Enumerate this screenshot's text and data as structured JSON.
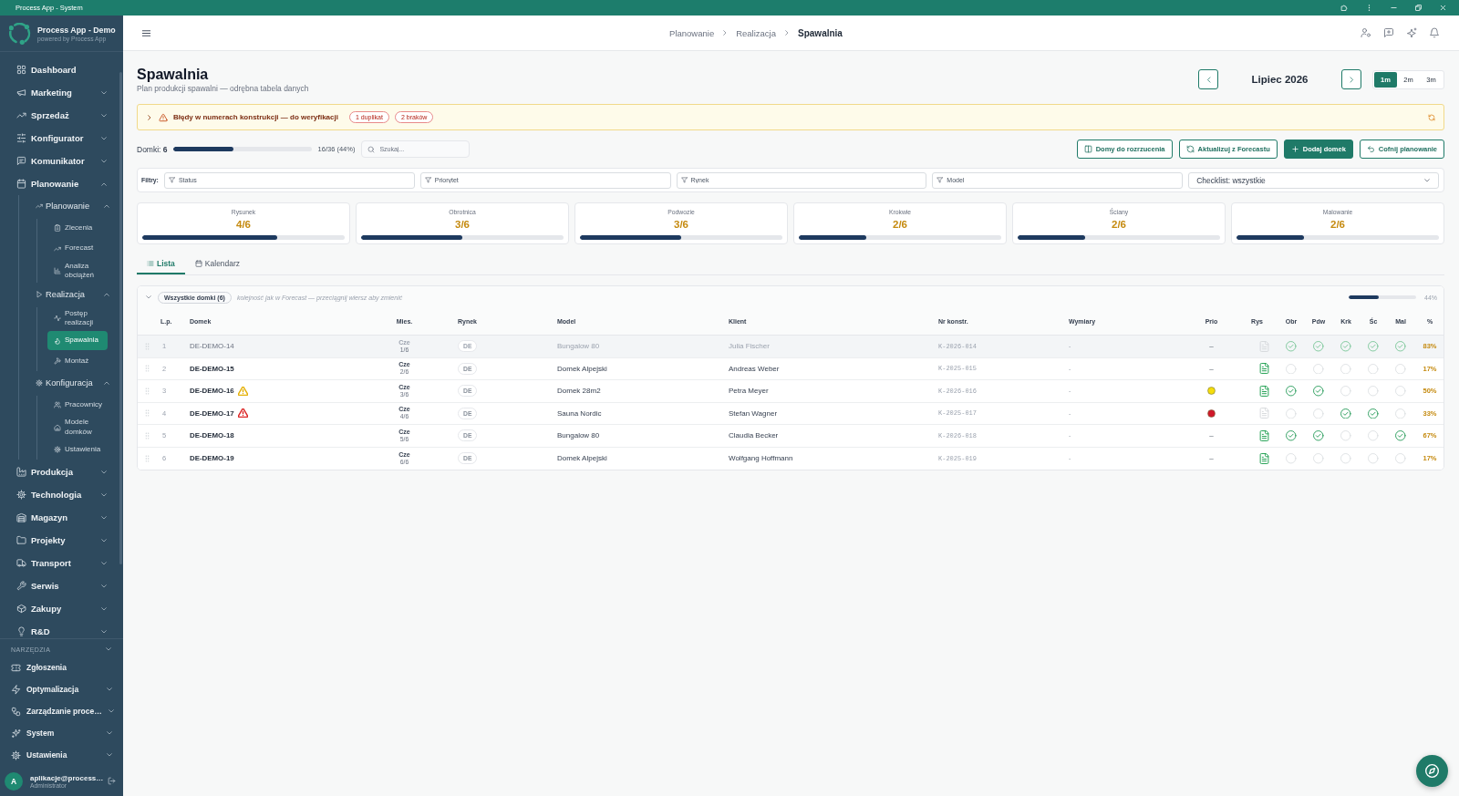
{
  "window": {
    "title": "Process App - System"
  },
  "sidebar": {
    "brand": {
      "name": "Process App - Demo",
      "tagline": "powered by Process App"
    },
    "items": [
      {
        "label": "Dashboard",
        "selected": false
      },
      {
        "label": "Marketing",
        "expanded": false,
        "selected": false
      },
      {
        "label": "Sprzedaż",
        "expanded": false,
        "selected": false
      },
      {
        "label": "Konfigurator",
        "expanded": false,
        "selected": false
      },
      {
        "label": "Komunikator",
        "expanded": false,
        "selected": false
      },
      {
        "label": "Planowanie",
        "expanded": true,
        "selected": false,
        "children": [
          {
            "label": "Planowanie",
            "expanded": true,
            "selected": false,
            "children": [
              {
                "label": "Zlecenia",
                "selected": false
              },
              {
                "label": "Forecast",
                "selected": false
              },
              {
                "label": "Analiza obciążeń",
                "selected": false
              }
            ]
          },
          {
            "label": "Realizacja",
            "expanded": true,
            "selected": false,
            "children": [
              {
                "label": "Postęp realizacji",
                "selected": false
              },
              {
                "label": "Spawalnia",
                "selected": true
              },
              {
                "label": "Montaż",
                "selected": false
              }
            ]
          },
          {
            "label": "Konfiguracja",
            "expanded": true,
            "selected": false,
            "children": [
              {
                "label": "Pracownicy",
                "selected": false
              },
              {
                "label": "Modele domków",
                "selected": false
              },
              {
                "label": "Ustawienia",
                "selected": false
              }
            ]
          }
        ]
      },
      {
        "label": "Produkcja",
        "expanded": false,
        "selected": false
      },
      {
        "label": "Technologia",
        "expanded": false,
        "selected": false
      },
      {
        "label": "Magazyn",
        "expanded": false,
        "selected": false
      },
      {
        "label": "Projekty",
        "expanded": false,
        "selected": false
      },
      {
        "label": "Transport",
        "expanded": false,
        "selected": false
      },
      {
        "label": "Serwis",
        "expanded": false,
        "selected": false
      },
      {
        "label": "Zakupy",
        "expanded": false,
        "selected": false
      },
      {
        "label": "R&D",
        "expanded": false,
        "selected": false
      }
    ],
    "tools": {
      "title": "NARZĘDZIA",
      "items": [
        {
          "label": "Zgłoszenia",
          "selected": false
        },
        {
          "label": "Optymalizacja",
          "expanded": false,
          "selected": false
        },
        {
          "label": "Zarządzanie proce…",
          "expanded": false,
          "selected": false
        },
        {
          "label": "System",
          "expanded": false,
          "selected": false
        },
        {
          "label": "Ustawienia",
          "expanded": false,
          "selected": false
        }
      ]
    },
    "user": {
      "initial": "A",
      "name": "aplikacje@process…",
      "role": "Administrator"
    }
  },
  "header": {
    "breadcrumb": [
      {
        "label": "Planowanie",
        "current": false
      },
      {
        "label": "Realizacja",
        "current": false
      },
      {
        "label": "Spawalnia",
        "current": true
      }
    ]
  },
  "page": {
    "title": "Spawalnia",
    "subtitle": "Plan produkcji spawalni — odrębna tabela danych"
  },
  "period": {
    "label": "Lipiec 2026",
    "ranges": [
      {
        "label": "1m",
        "selected": true
      },
      {
        "label": "2m",
        "selected": false
      },
      {
        "label": "3m",
        "selected": false
      }
    ]
  },
  "alert": {
    "expanded": false,
    "text": "Błędy w numerach konstrukcji — do weryfikacji",
    "badges": [
      "1 duplikat",
      "2 braków"
    ]
  },
  "summary": {
    "text": "Domki: **6**",
    "level": 0.44,
    "progress": "16/36 (44%)"
  },
  "search": {
    "placeholder": "Szukaj..."
  },
  "actions": [
    {
      "label": "Domy do rozrzucenia",
      "kind": "outline"
    },
    {
      "label": "Aktualizuj z Forecastu",
      "kind": "outline"
    },
    {
      "label": "Dodaj domek",
      "kind": "primary"
    },
    {
      "label": "Cofnij planowanie",
      "kind": "outline"
    }
  ],
  "filters": {
    "label": "Filtry:",
    "fields": [
      {
        "placeholder": "Status"
      },
      {
        "placeholder": "Priorytet"
      },
      {
        "placeholder": "Rynek"
      },
      {
        "placeholder": "Model"
      }
    ],
    "checklist": "Checklist: wszystkie"
  },
  "stages": [
    {
      "label": "Rysunek",
      "value": "4/6",
      "level": 0.667
    },
    {
      "label": "Obrotnica",
      "value": "3/6",
      "level": 0.5
    },
    {
      "label": "Podwozie",
      "value": "3/6",
      "level": 0.5
    },
    {
      "label": "Krokwie",
      "value": "2/6",
      "level": 0.333
    },
    {
      "label": "Ściany",
      "value": "2/6",
      "level": 0.333
    },
    {
      "label": "Malowanie",
      "value": "2/6",
      "level": 0.333
    }
  ],
  "view_tabs": [
    {
      "label": "Lista",
      "selected": true
    },
    {
      "label": "Kalendarz",
      "selected": false
    }
  ],
  "table": {
    "group": {
      "expanded": true,
      "label": "Wszystkie domki (6)",
      "hint": "kolejność jak w Forecast — przeciągnij wiersz aby zmienić",
      "level": 0.44,
      "percent": "44%"
    },
    "columns": [
      "L.p.",
      "Domek",
      "Mies.",
      "Rynek",
      "Model",
      "Klient",
      "Nr konstr.",
      "Wymiary",
      "Prio",
      "Rys",
      "Obr",
      "Pdw",
      "Krk",
      "Śc",
      "Mal",
      "%"
    ],
    "rows": [
      {
        "dimmed": true,
        "lp": "1",
        "house": "DE-DEMO-14",
        "month": "Cze",
        "month_index": "1/6",
        "market": "DE",
        "model": "Bungalow 80",
        "client": "Julia Fischer",
        "construction_no": "K-2026-014",
        "dimensions": "-",
        "prio": {
          "kind": "text",
          "text": "–"
        },
        "drawing": false,
        "checks": [
          {
            "checked": true
          },
          {
            "checked": true
          },
          {
            "checked": true
          },
          {
            "checked": true
          },
          {
            "checked": true
          }
        ],
        "percent": "83%"
      },
      {
        "dimmed": false,
        "lp": "2",
        "house": "DE-DEMO-15",
        "month": "Cze",
        "month_index": "2/6",
        "market": "DE",
        "model": "Domek Alpejski",
        "client": "Andreas Weber",
        "construction_no": "K-2025-015",
        "dimensions": "-",
        "prio": {
          "kind": "text",
          "text": "–"
        },
        "drawing": true,
        "checks": [
          {
            "checked": false
          },
          {
            "checked": false
          },
          {
            "checked": false
          },
          {
            "checked": false
          },
          {
            "checked": false
          }
        ],
        "percent": "17%"
      },
      {
        "dimmed": false,
        "lp": "3",
        "house": "DE-DEMO-16",
        "warning": {
          "color": "#e5b007"
        },
        "month": "Cze",
        "month_index": "3/6",
        "market": "DE",
        "model": "Domek 28m2",
        "client": "Petra Meyer",
        "construction_no": "K-2026-016",
        "dimensions": "-",
        "prio": {
          "kind": "dot",
          "color": "#f5dd0c"
        },
        "drawing": true,
        "checks": [
          {
            "checked": true
          },
          {
            "checked": true
          },
          {
            "checked": false
          },
          {
            "checked": false
          },
          {
            "checked": false
          }
        ],
        "percent": "50%"
      },
      {
        "dimmed": false,
        "lp": "4",
        "house": "DE-DEMO-17",
        "warning": {
          "color": "#dc2626"
        },
        "month": "Cze",
        "month_index": "4/6",
        "market": "DE",
        "model": "Sauna Nordic",
        "client": "Stefan Wagner",
        "construction_no": "K-2025-017",
        "dimensions": "-",
        "prio": {
          "kind": "dot",
          "color": "#d0182a"
        },
        "drawing": false,
        "checks": [
          {
            "checked": false
          },
          {
            "checked": false
          },
          {
            "checked": true
          },
          {
            "checked": true
          },
          {
            "checked": false
          }
        ],
        "percent": "33%"
      },
      {
        "dimmed": false,
        "lp": "5",
        "house": "DE-DEMO-18",
        "month": "Cze",
        "month_index": "5/6",
        "market": "DE",
        "model": "Bungalow 80",
        "client": "Claudia Becker",
        "construction_no": "K-2026-018",
        "dimensions": "-",
        "prio": {
          "kind": "text",
          "text": "–"
        },
        "drawing": true,
        "checks": [
          {
            "checked": true
          },
          {
            "checked": true
          },
          {
            "checked": false
          },
          {
            "checked": false
          },
          {
            "checked": true
          }
        ],
        "percent": "67%"
      },
      {
        "dimmed": false,
        "lp": "6",
        "house": "DE-DEMO-19",
        "month": "Cze",
        "month_index": "6/6",
        "market": "DE",
        "model": "Domek Alpejski",
        "client": "Wolfgang Hoffmann",
        "construction_no": "K-2025-019",
        "dimensions": "-",
        "prio": {
          "kind": "text",
          "text": "–"
        },
        "drawing": true,
        "checks": [
          {
            "checked": false
          },
          {
            "checked": false
          },
          {
            "checked": false
          },
          {
            "checked": false
          },
          {
            "checked": false
          }
        ],
        "percent": "17%"
      }
    ]
  }
}
